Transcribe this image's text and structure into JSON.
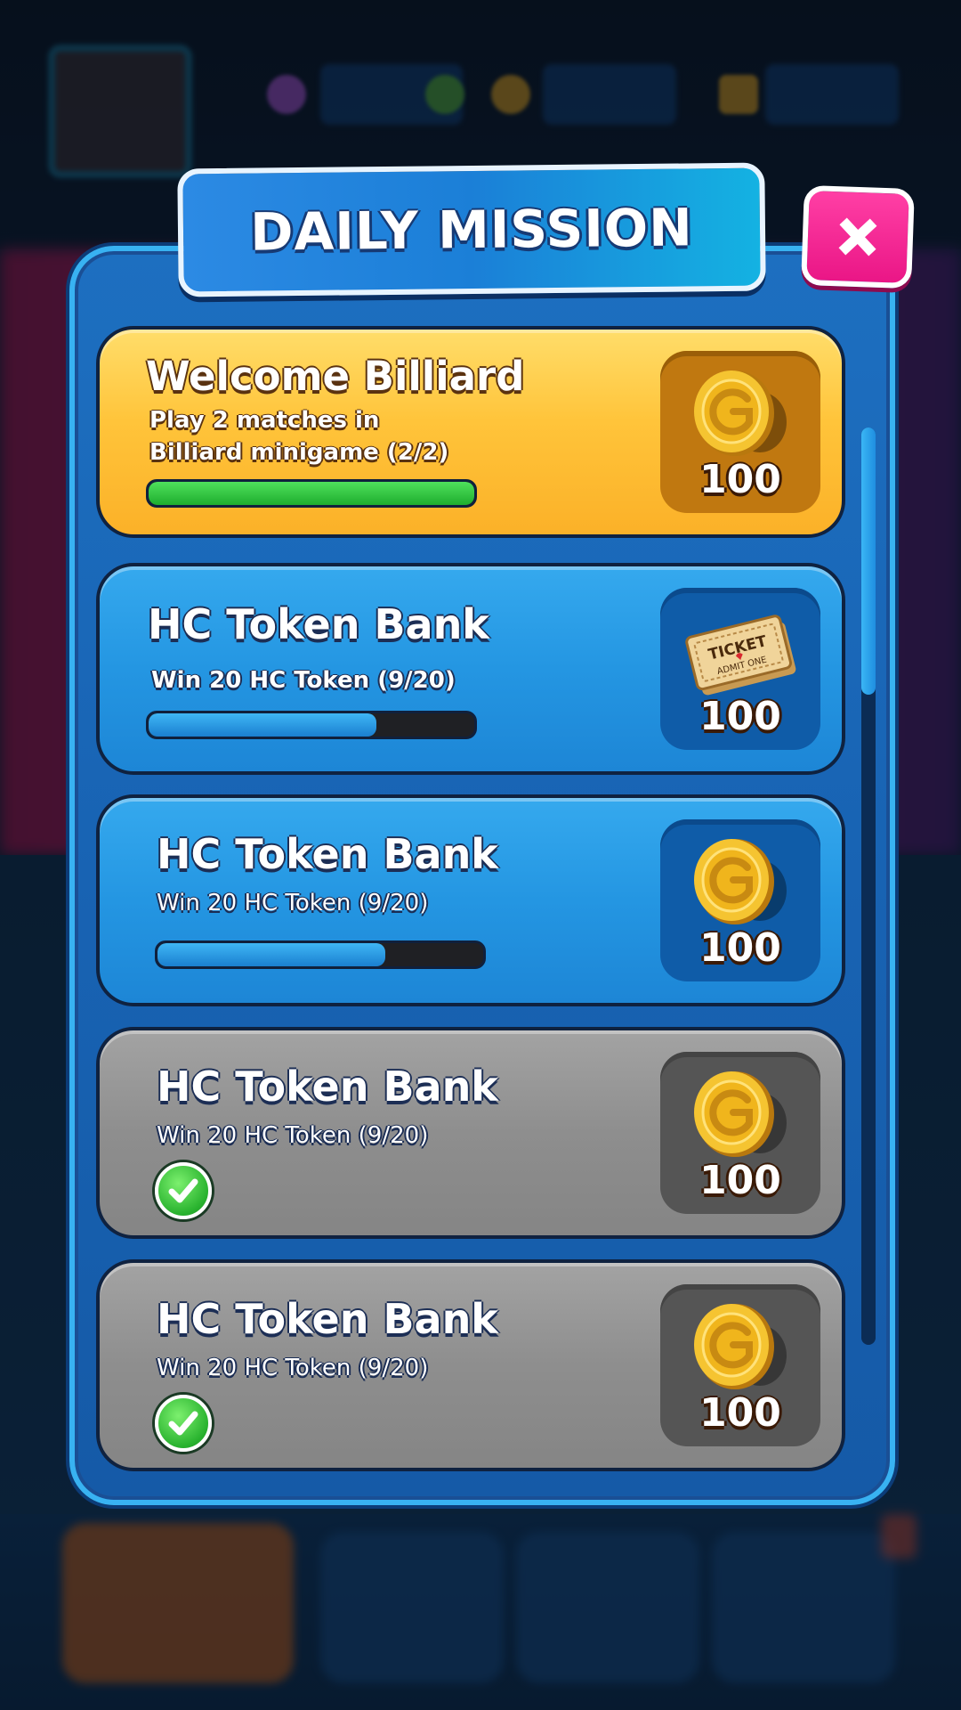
{
  "title": "DAILY MISSION",
  "missions": [
    {
      "title": "Welcome Billiard",
      "desc_line1": "Play 2 matches in",
      "desc_line2": "Billiard minigame (2/2)",
      "progress": 1.0,
      "state": "in-progress",
      "reward_icon": "gold-coin-icon",
      "reward_amount": "100"
    },
    {
      "title": "HC Token Bank",
      "desc": "Win 20 HC Token (9/20)",
      "progress": 0.7,
      "state": "in-progress",
      "reward_icon": "ticket-icon",
      "reward_amount": "100",
      "ticket_text": "TICKET",
      "ticket_sub": "ADMIT ONE"
    },
    {
      "title": "HC Token Bank",
      "desc": "Win 20 HC Token (9/20)",
      "progress": 0.7,
      "state": "in-progress",
      "reward_icon": "gold-coin-icon",
      "reward_amount": "100"
    },
    {
      "title": "HC Token Bank",
      "desc": "Win 20 HC Token (9/20)",
      "state": "completed",
      "reward_icon": "gold-coin-icon",
      "reward_amount": "100"
    },
    {
      "title": "HC Token Bank",
      "desc": "Win 20 HC Token (9/20)",
      "state": "completed",
      "reward_icon": "gold-coin-icon",
      "reward_amount": "100"
    }
  ],
  "colors": {
    "gold_card": "#ffc43a",
    "blue_card": "#2496e2",
    "grey_card": "#8e8e8e",
    "close_button": "#f0208f",
    "progress_green": "#1eae2e",
    "progress_blue": "#1a7fd0"
  }
}
